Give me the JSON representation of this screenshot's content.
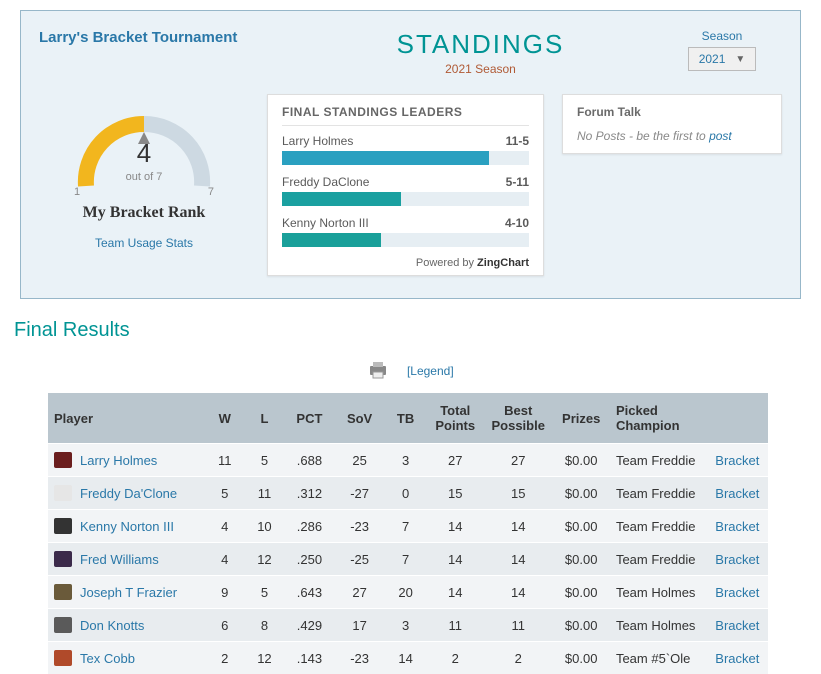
{
  "tournament_name": "Larry's Bracket Tournament",
  "standings_title": "STANDINGS",
  "season_subtitle": "2021 Season",
  "season_label": "Season",
  "season_selected": "2021",
  "rank": {
    "position": "4",
    "out_of": "out of 7",
    "min": "1",
    "max": "7",
    "label": "My Bracket Rank",
    "team_usage": "Team Usage Stats"
  },
  "leaders": {
    "title": "FINAL STANDINGS LEADERS",
    "items": [
      {
        "name": "Larry Holmes",
        "record": "11-5"
      },
      {
        "name": "Freddy DaClone",
        "record": "5-11"
      },
      {
        "name": "Kenny Norton III",
        "record": "4-10"
      }
    ],
    "powered_prefix": "Powered by ",
    "powered_brand": "ZingChart"
  },
  "chart_data": {
    "type": "bar",
    "orientation": "horizontal",
    "title": "FINAL STANDINGS LEADERS",
    "xlabel": "",
    "ylabel": "",
    "categories": [
      "Larry Holmes",
      "Freddy DaClone",
      "Kenny Norton III"
    ],
    "records": [
      "11-5",
      "5-11",
      "4-10"
    ],
    "values": [
      11,
      5,
      4
    ],
    "value_max_estimate": 13
  },
  "forum": {
    "title": "Forum Talk",
    "empty_prefix": "No Posts - be the first to ",
    "post_link": "post"
  },
  "final_results_title": "Final Results",
  "legend_link": "[Legend]",
  "table": {
    "headers": {
      "player": "Player",
      "w": "W",
      "l": "L",
      "pct": "PCT",
      "sov": "SoV",
      "tb": "TB",
      "total": "Total Points",
      "best": "Best Possible",
      "prizes": "Prizes",
      "champ": "Picked Champion",
      "bracket": ""
    },
    "rows": [
      {
        "avatar_bg": "#6b1e1e",
        "player": "Larry Holmes",
        "w": "11",
        "l": "5",
        "pct": ".688",
        "sov": "25",
        "tb": "3",
        "total": "27",
        "best": "27",
        "prizes": "$0.00",
        "champ": "Team Freddie",
        "bracket": "Bracket"
      },
      {
        "avatar_bg": "#e6e6e6",
        "player": "Freddy Da'Clone",
        "w": "5",
        "l": "11",
        "pct": ".312",
        "sov": "-27",
        "tb": "0",
        "total": "15",
        "best": "15",
        "prizes": "$0.00",
        "champ": "Team Freddie",
        "bracket": "Bracket"
      },
      {
        "avatar_bg": "#333333",
        "player": "Kenny Norton III",
        "w": "4",
        "l": "10",
        "pct": ".286",
        "sov": "-23",
        "tb": "7",
        "total": "14",
        "best": "14",
        "prizes": "$0.00",
        "champ": "Team Freddie",
        "bracket": "Bracket"
      },
      {
        "avatar_bg": "#3b2a4a",
        "player": "Fred Williams",
        "w": "4",
        "l": "12",
        "pct": ".250",
        "sov": "-25",
        "tb": "7",
        "total": "14",
        "best": "14",
        "prizes": "$0.00",
        "champ": "Team Freddie",
        "bracket": "Bracket"
      },
      {
        "avatar_bg": "#6a5a3a",
        "player": "Joseph T Frazier",
        "w": "9",
        "l": "5",
        "pct": ".643",
        "sov": "27",
        "tb": "20",
        "total": "14",
        "best": "14",
        "prizes": "$0.00",
        "champ": "Team Holmes",
        "bracket": "Bracket"
      },
      {
        "avatar_bg": "#5a5a5a",
        "player": "Don Knotts",
        "w": "6",
        "l": "8",
        "pct": ".429",
        "sov": "17",
        "tb": "3",
        "total": "11",
        "best": "11",
        "prizes": "$0.00",
        "champ": "Team Holmes",
        "bracket": "Bracket"
      },
      {
        "avatar_bg": "#b04a2a",
        "player": "Tex Cobb",
        "w": "2",
        "l": "12",
        "pct": ".143",
        "sov": "-23",
        "tb": "14",
        "total": "2",
        "best": "2",
        "prizes": "$0.00",
        "champ": "Team #5`Ole",
        "bracket": "Bracket"
      }
    ]
  }
}
